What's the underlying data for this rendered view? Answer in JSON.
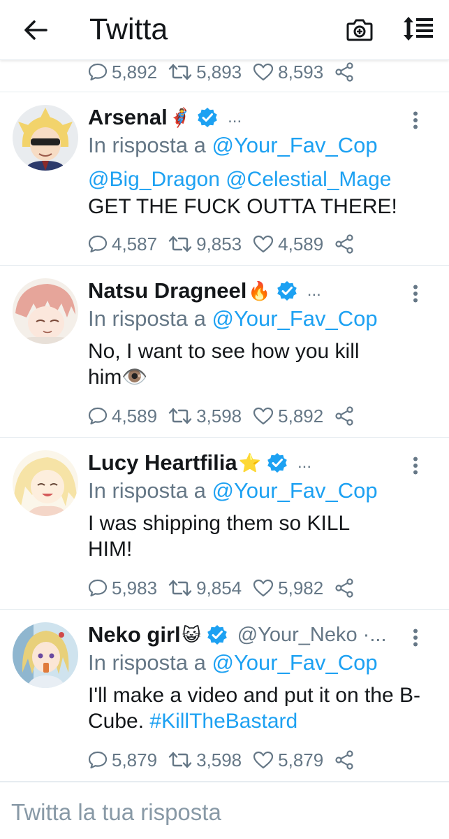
{
  "header": {
    "title": "Twitta",
    "back_icon": "arrow-left-icon",
    "camera_icon": "camera-add-icon",
    "sort_icon": "sort-icon"
  },
  "partial_tweet": {
    "replies": "5,892",
    "retweets": "5,893",
    "likes": "8,593"
  },
  "tweets": [
    {
      "name": "Arsenal",
      "emoji": "🦸",
      "handle": "",
      "ellipsis": "...",
      "reply_prefix": "In risposta a",
      "reply_to": "@Your_Fav_Cop",
      "body_links": "@Big_Dragon @Celestial_Mage",
      "body_line": "GET THE FUCK OUTTA THERE!",
      "replies": "4,587",
      "retweets": "9,853",
      "likes": "4,589"
    },
    {
      "name": "Natsu Dragneel",
      "emoji": "🔥",
      "handle": "",
      "ellipsis": "...",
      "reply_prefix": "In risposta a",
      "reply_to": "@Your_Fav_Cop",
      "body": "No, I want to see how you kill him👁️",
      "replies": "4,589",
      "retweets": "3,598",
      "likes": "5,892"
    },
    {
      "name": "Lucy Heartfilia",
      "emoji": "⭐",
      "handle": "",
      "ellipsis": "...",
      "reply_prefix": "In risposta a",
      "reply_to": "@Your_Fav_Cop",
      "body": "I was shipping them so KILL HIM!",
      "replies": "5,983",
      "retweets": "9,854",
      "likes": "5,982"
    },
    {
      "name": "Neko girl",
      "emoji": "😺",
      "handle": "@Your_Neko ·...",
      "ellipsis": "",
      "reply_prefix": "In risposta a",
      "reply_to": "@Your_Fav_Cop",
      "body_text": "I'll make a video and put it on the B-Cube.",
      "hashtag": "#KillTheBastard",
      "replies": "5,879",
      "retweets": "3,598",
      "likes": "5,879"
    }
  ],
  "reply_bar": {
    "placeholder": "Twitta la tua risposta"
  },
  "colors": {
    "link": "#1da1f2",
    "muted": "#657786",
    "text": "#14171a",
    "verified": "#1da1f2"
  }
}
